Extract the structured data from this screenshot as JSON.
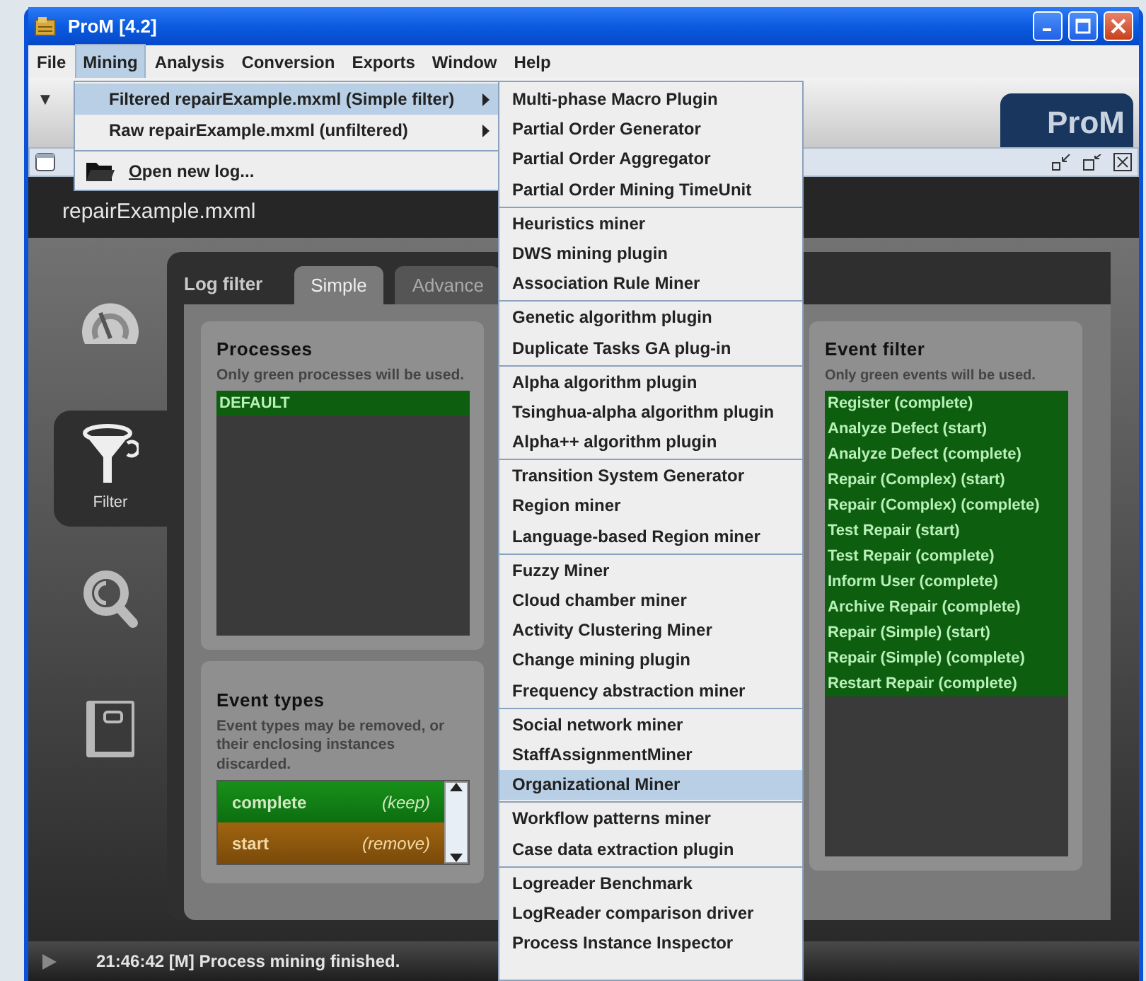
{
  "window": {
    "title": "ProM [4.2]"
  },
  "menubar": [
    {
      "label": "File",
      "selected": false
    },
    {
      "label": "Mining",
      "selected": true
    },
    {
      "label": "Analysis",
      "selected": false
    },
    {
      "label": "Conversion",
      "selected": false
    },
    {
      "label": "Exports",
      "selected": false
    },
    {
      "label": "Window",
      "selected": false
    },
    {
      "label": "Help",
      "selected": false
    }
  ],
  "toolbar": {
    "toggle": "▼",
    "logo": "ProM"
  },
  "mining_menu": {
    "items": [
      {
        "kind": "submenu",
        "label": "Filtered repairExample.mxml (Simple filter)",
        "selected": true
      },
      {
        "kind": "submenu",
        "label": "Raw repairExample.mxml (unfiltered)",
        "selected": false
      },
      {
        "kind": "separator"
      },
      {
        "kind": "open",
        "label": "Open new log...",
        "selected": false
      }
    ]
  },
  "submenu": {
    "groups": [
      {
        "items": [
          {
            "label": "Multi-phase Macro Plugin",
            "selected": false
          },
          {
            "label": "Partial Order Generator",
            "selected": false
          },
          {
            "label": "Partial Order Aggregator",
            "selected": false
          },
          {
            "label": "Partial Order Mining TimeUnit",
            "selected": false
          }
        ]
      },
      {
        "items": [
          {
            "label": "Heuristics miner",
            "selected": false
          },
          {
            "label": "DWS mining plugin",
            "selected": false
          },
          {
            "label": "Association Rule Miner",
            "selected": false
          }
        ]
      },
      {
        "items": [
          {
            "label": "Genetic algorithm plugin",
            "selected": false
          },
          {
            "label": "Duplicate Tasks GA plug-in",
            "selected": false
          }
        ]
      },
      {
        "items": [
          {
            "label": "Alpha algorithm plugin",
            "selected": false
          },
          {
            "label": "Tsinghua-alpha algorithm plugin",
            "selected": false
          },
          {
            "label": "Alpha++ algorithm plugin",
            "selected": false
          }
        ]
      },
      {
        "items": [
          {
            "label": "Transition System Generator",
            "selected": false
          },
          {
            "label": "Region miner",
            "selected": false
          },
          {
            "label": "Language-based Region miner",
            "selected": false
          }
        ]
      },
      {
        "items": [
          {
            "label": "Fuzzy Miner",
            "selected": false
          },
          {
            "label": "Cloud chamber miner",
            "selected": false
          },
          {
            "label": "Activity Clustering Miner",
            "selected": false
          },
          {
            "label": "Change mining plugin",
            "selected": false
          },
          {
            "label": "Frequency abstraction miner",
            "selected": false
          }
        ]
      },
      {
        "items": [
          {
            "label": "Social network miner",
            "selected": false
          },
          {
            "label": "StaffAssignmentMiner",
            "selected": false
          },
          {
            "label": "Organizational Miner",
            "selected": true
          }
        ]
      },
      {
        "items": [
          {
            "label": "Workflow patterns miner",
            "selected": false
          },
          {
            "label": "Case data extraction plugin",
            "selected": false
          }
        ]
      },
      {
        "items": [
          {
            "label": "Logreader Benchmark",
            "selected": false
          },
          {
            "label": "LogReader comparison driver",
            "selected": false
          },
          {
            "label": "Process Instance Inspector",
            "selected": false
          }
        ]
      }
    ]
  },
  "document": {
    "title": "repairExample.mxml"
  },
  "sidebar": [
    {
      "kind": "dashboard",
      "selected": false
    },
    {
      "kind": "filter",
      "label": "Filter",
      "selected": true
    },
    {
      "kind": "inspect",
      "selected": false
    },
    {
      "kind": "book",
      "selected": false
    }
  ],
  "tabs": {
    "label": "Log filter",
    "items": [
      {
        "label": "Simple",
        "selected": true
      },
      {
        "label": "Advance",
        "selected": false
      }
    ]
  },
  "processes": {
    "title": "Processes",
    "hint": "Only green processes will be used.",
    "items": [
      {
        "label": "DEFAULT",
        "used": true
      }
    ]
  },
  "event_types": {
    "title": "Event types",
    "hint": "Event types may be removed, or their enclosing instances discarded.",
    "items": [
      {
        "name": "complete",
        "action": "(keep)",
        "kind": "keep"
      },
      {
        "name": "start",
        "action": "(remove)",
        "kind": "remove"
      }
    ]
  },
  "event_filter": {
    "title": "Event filter",
    "hint": "Only green events will be used.",
    "items": [
      {
        "label": "Register (complete)",
        "used": true
      },
      {
        "label": "Analyze Defect (start)",
        "used": true
      },
      {
        "label": "Analyze Defect (complete)",
        "used": true
      },
      {
        "label": "Repair (Complex) (start)",
        "used": true
      },
      {
        "label": "Repair (Complex) (complete)",
        "used": true
      },
      {
        "label": "Test Repair (start)",
        "used": true
      },
      {
        "label": "Test Repair (complete)",
        "used": true
      },
      {
        "label": "Inform User (complete)",
        "used": true
      },
      {
        "label": "Archive Repair (complete)",
        "used": true
      },
      {
        "label": "Repair (Simple) (start)",
        "used": true
      },
      {
        "label": "Repair (Simple) (complete)",
        "used": true
      },
      {
        "label": "Restart Repair (complete)",
        "used": true
      }
    ]
  },
  "status_bar": {
    "message": "21:46:42 [M] Process mining finished."
  }
}
